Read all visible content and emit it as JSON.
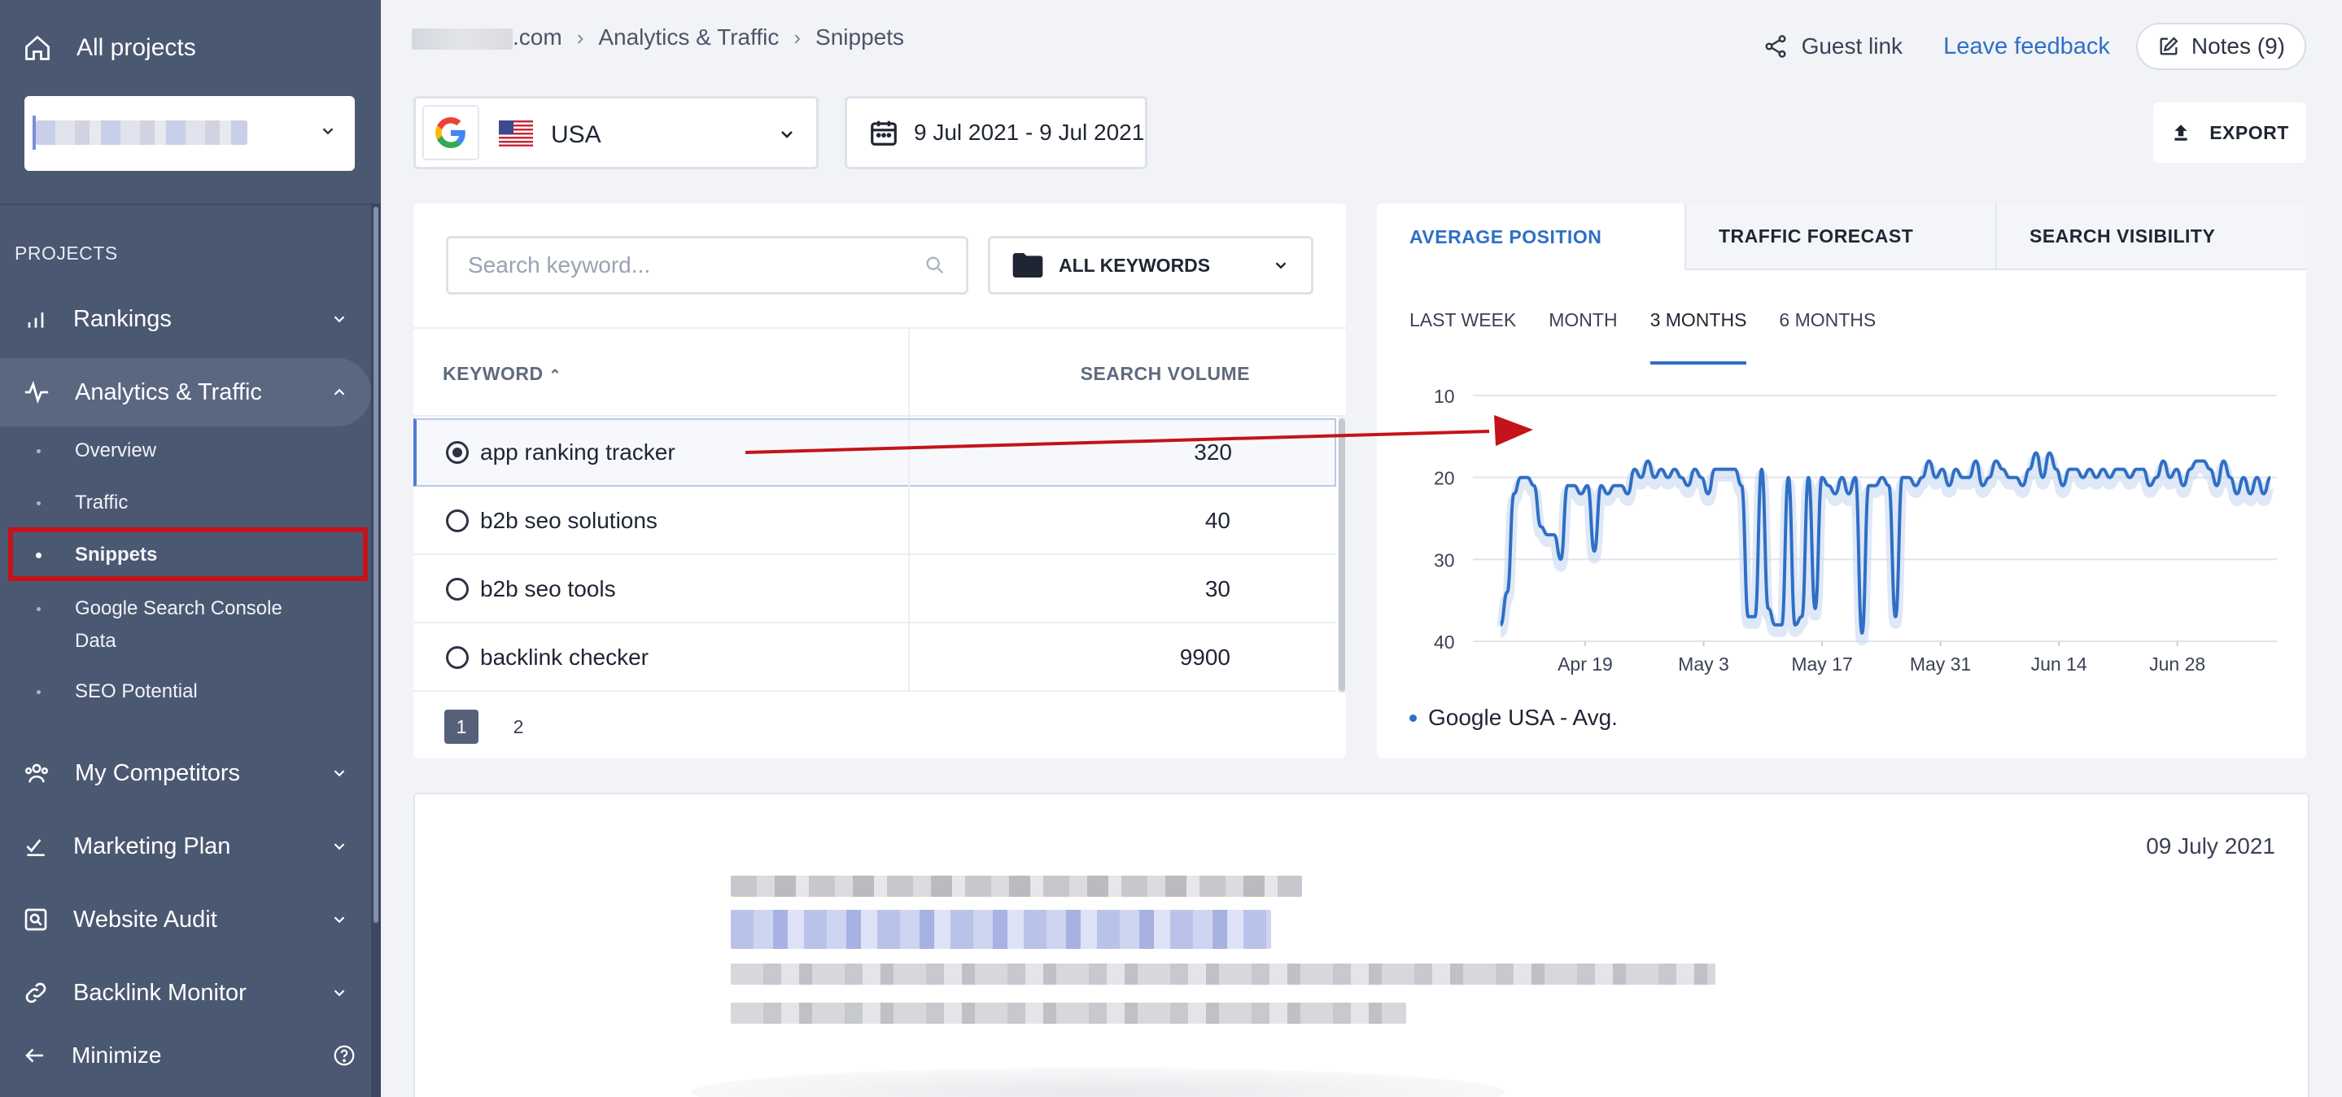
{
  "sidebar": {
    "all_projects": "All projects",
    "projects_heading": "PROJECTS",
    "items": [
      {
        "label": "Rankings",
        "icon": "bar-chart-icon"
      },
      {
        "label": "Analytics & Traffic",
        "icon": "pulse-icon"
      },
      {
        "label": "My Competitors",
        "icon": "users-icon"
      },
      {
        "label": "Marketing Plan",
        "icon": "checklist-icon"
      },
      {
        "label": "Website Audit",
        "icon": "audit-icon"
      },
      {
        "label": "Backlink Monitor",
        "icon": "link-icon"
      }
    ],
    "sub_items": [
      {
        "label": "Overview"
      },
      {
        "label": "Traffic"
      },
      {
        "label": "Snippets"
      },
      {
        "label": "Google Search Console Data"
      },
      {
        "label": "SEO Potential"
      }
    ],
    "minimize": "Minimize"
  },
  "breadcrumb": {
    "domain_suffix": ".com",
    "section": "Analytics & Traffic",
    "page": "Snippets"
  },
  "header": {
    "guest_link": "Guest link",
    "leave_feedback": "Leave feedback",
    "notes": "Notes (9)"
  },
  "filters": {
    "country": "USA",
    "date_range": "9 Jul 2021 - 9 Jul 2021",
    "export": "EXPORT"
  },
  "keywords": {
    "search_placeholder": "Search keyword...",
    "group": "ALL KEYWORDS",
    "col_keyword": "KEYWORD",
    "col_volume": "SEARCH VOLUME",
    "rows": [
      {
        "keyword": "app ranking tracker",
        "volume": "320"
      },
      {
        "keyword": "b2b seo solutions",
        "volume": "40"
      },
      {
        "keyword": "b2b seo tools",
        "volume": "30"
      },
      {
        "keyword": "backlink checker",
        "volume": "9900"
      }
    ],
    "pages": [
      "1",
      "2"
    ]
  },
  "chart_panel": {
    "tabs": [
      "AVERAGE POSITION",
      "TRAFFIC FORECAST",
      "SEARCH VISIBILITY"
    ],
    "periods": [
      "LAST WEEK",
      "MONTH",
      "3 MONTHS",
      "6 MONTHS"
    ],
    "legend": "Google USA - Avg."
  },
  "chart_data": {
    "type": "line",
    "title": "",
    "xlabel": "",
    "ylabel": "",
    "ylim": [
      40,
      10
    ],
    "y_inverted": true,
    "yticks": [
      "10",
      "20",
      "30",
      "40"
    ],
    "xticks": [
      "Apr 19",
      "May 3",
      "May 17",
      "May 31",
      "Jun 14",
      "Jun 28"
    ],
    "x_start": "2021-04-09",
    "x_end": "2021-07-09",
    "color": "#2f6fc5",
    "series": [
      {
        "name": "Google USA - Avg.",
        "values": [
          38,
          34,
          22,
          20,
          20,
          21,
          26,
          27,
          27,
          30,
          21,
          21,
          22,
          21,
          29,
          21,
          22,
          21,
          21,
          22,
          19,
          20,
          18,
          20,
          19,
          20,
          19,
          20,
          21,
          19,
          20,
          22,
          19,
          19,
          19,
          19,
          21,
          37,
          37,
          19,
          36,
          38,
          38,
          20,
          38,
          37,
          20,
          36,
          20,
          21,
          22,
          20,
          22,
          20,
          39,
          21,
          21,
          20,
          21,
          37,
          20,
          20,
          21,
          20,
          18,
          20,
          19,
          21,
          19,
          20,
          20,
          18,
          21,
          20,
          18,
          19,
          20,
          20,
          21,
          19,
          17,
          20,
          17,
          19,
          21,
          19,
          19,
          20,
          19,
          20,
          19,
          20,
          19,
          19,
          20,
          19,
          19,
          21,
          20,
          18,
          20,
          19,
          21,
          19,
          18,
          18,
          19,
          21,
          18,
          20,
          22,
          20,
          22,
          20,
          22,
          20
        ]
      }
    ]
  },
  "snippet": {
    "date": "09 July 2021"
  }
}
